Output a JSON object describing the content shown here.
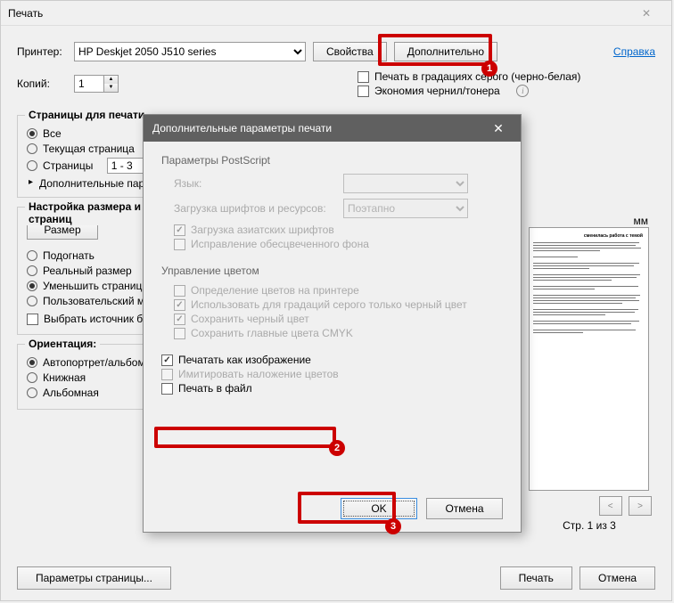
{
  "main": {
    "title": "Печать",
    "printer_label": "Принтер:",
    "printer_value": "HP Deskjet 2050 J510 series",
    "properties_btn": "Свойства",
    "advanced_btn": "Дополнительно",
    "help_link": "Справка",
    "copies_label": "Копий:",
    "copies_value": "1",
    "grayscale": "Печать в градациях серого (черно-белая)",
    "ink_save": "Экономия чернил/тонера",
    "pages": {
      "legend": "Страницы для печати",
      "all": "Все",
      "current": "Текущая страница",
      "pages": "Страницы",
      "pages_value": "1 - 3",
      "more": "Дополнительные параметры"
    },
    "sizing": {
      "legend": "Настройка размера и обработки страниц",
      "size_btn": "Размер",
      "fit": "Подогнать",
      "real": "Реальный размер",
      "shrink": "Уменьшить страницы",
      "custom": "Пользовательский масштаб",
      "source": "Выбрать источник бумаги"
    },
    "orientation": {
      "legend": "Ориентация:",
      "auto": "Автопортрет/альбом",
      "portrait": "Книжная",
      "landscape": "Альбомная"
    },
    "preview_mm": "мм",
    "preview_status": "Стр. 1 из 3",
    "page_setup": "Параметры страницы...",
    "print_btn": "Печать",
    "cancel_btn": "Отмена",
    "preview_heading": "сменилась работа с темой"
  },
  "sub": {
    "title": "Дополнительные параметры печати",
    "ps": "Параметры PostScript",
    "lang": "Язык:",
    "fontload": "Загрузка шрифтов и ресурсов:",
    "fontload_val": "Поэтапно",
    "asian": "Загрузка азиатских шрифтов",
    "bgfix": "Исправление обесцвеченного фона",
    "color": "Управление цветом",
    "c1": "Определение цветов на принтере",
    "c2": "Использовать для градаций серого только черный цвет",
    "c3": "Сохранить черный цвет",
    "c4": "Сохранить главные цвета CMYK",
    "asimg": "Печатать как изображение",
    "overlay": "Имитировать наложение цветов",
    "tofile": "Печать в файл",
    "ok": "OK",
    "cancel": "Отмена"
  },
  "callouts": {
    "1": "1",
    "2": "2",
    "3": "3"
  }
}
